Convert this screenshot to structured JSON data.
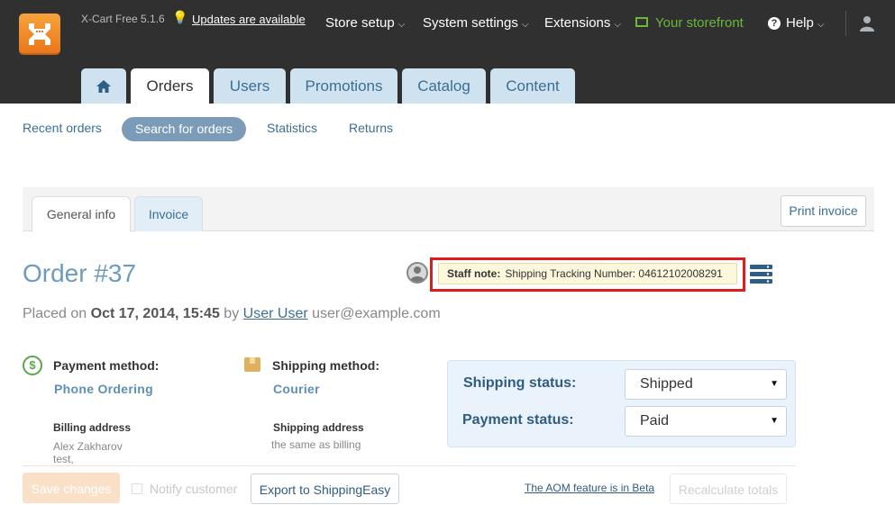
{
  "topbar": {
    "version": "X-Cart Free 5.1.6",
    "updates": "Updates are available",
    "nav": [
      {
        "label": "Store setup"
      },
      {
        "label": "System settings"
      },
      {
        "label": "Extensions"
      }
    ],
    "storefront": "Your storefront",
    "help": "Help",
    "icons": {
      "logo": "xcart-logo",
      "bulb": "lightbulb-icon",
      "user": "user-icon",
      "monitor": "monitor-icon",
      "help": "help-circle-icon"
    }
  },
  "main_tabs": {
    "home": "home-icon",
    "items": [
      "Orders",
      "Users",
      "Promotions",
      "Catalog",
      "Content"
    ],
    "active": "Orders"
  },
  "subnav": [
    "Recent orders",
    "Search for orders",
    "Statistics",
    "Returns"
  ],
  "order": {
    "tabs": [
      "General info",
      "Invoice"
    ],
    "print_invoice": "Print invoice",
    "title": "Order #37",
    "staff_note_label": "Staff note:",
    "staff_note_text": "Shipping Tracking Number: 04612102008291",
    "placed_prefix": "Placed on",
    "placed_date": "Oct 17, 2014, 15:45",
    "by": "by",
    "user_name": "User User",
    "user_email": "user@example.com",
    "payment_label": "Payment method:",
    "payment_value": "Phone Ordering",
    "shipping_label": "Shipping method:",
    "shipping_value": "Courier",
    "billing_label": "Billing address",
    "billing_lines": [
      "Alex Zakharov",
      "test,"
    ],
    "shipping_addr_label": "Shipping address",
    "shipping_addr_value": "the same as billing",
    "shipping_status_label": "Shipping status:",
    "shipping_status_value": "Shipped",
    "payment_status_label": "Payment status:",
    "payment_status_value": "Paid"
  },
  "actions": {
    "save": "Save changes",
    "notify": "Notify customer",
    "export": "Export to ShippingEasy",
    "aom": "The AOM feature is in Beta",
    "recalculate": "Recalculate totals"
  },
  "colors": {
    "topbar": "#303030",
    "tab_inactive": "#cfe2ef",
    "link": "#3c6e95",
    "storefront_green": "#69b83a",
    "highlight_red": "#e01b1b",
    "status_bg": "#eaf3fb"
  }
}
